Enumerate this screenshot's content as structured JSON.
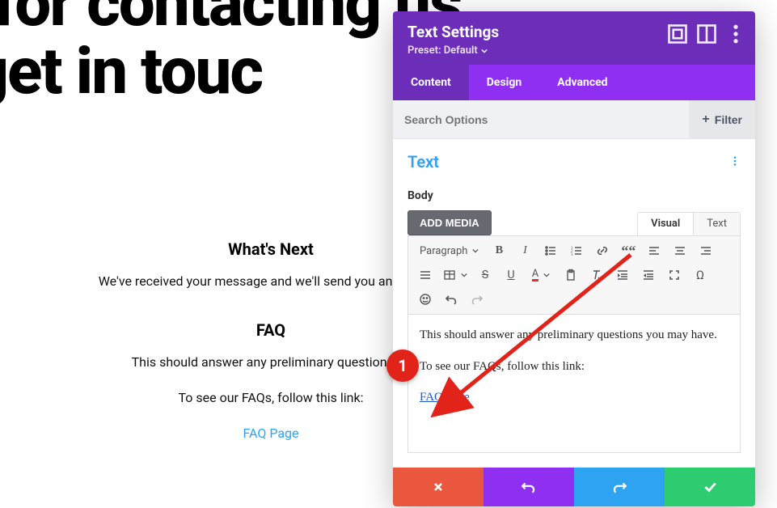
{
  "page": {
    "headline": "k you for contacting us.\nWe'll get in touch",
    "whats_next_heading": "What's Next",
    "received_msg": "We've received your message and we'll send you an email wi",
    "faq_heading": "FAQ",
    "faq_desc": "This should answer any preliminary questions yo",
    "faq_follow": "To see our FAQs, follow this link:",
    "faq_link_label": "FAQ Page"
  },
  "panel": {
    "title": "Text Settings",
    "preset_label": "Preset: Default",
    "tabs": {
      "content": "Content",
      "design": "Design",
      "advanced": "Advanced"
    },
    "search_placeholder": "Search Options",
    "filter_label": "Filter",
    "section_title": "Text",
    "body_label": "Body",
    "add_media_label": "ADD MEDIA",
    "editor_tabs": {
      "visual": "Visual",
      "text": "Text"
    },
    "toolbar": {
      "paragraph_label": "Paragraph"
    },
    "editor": {
      "p1": "This should answer any preliminary questions you may have.",
      "p2": "To see our FAQs, follow this link:",
      "link_label": "FAQ Page"
    }
  },
  "annotation": {
    "badge": "1"
  }
}
